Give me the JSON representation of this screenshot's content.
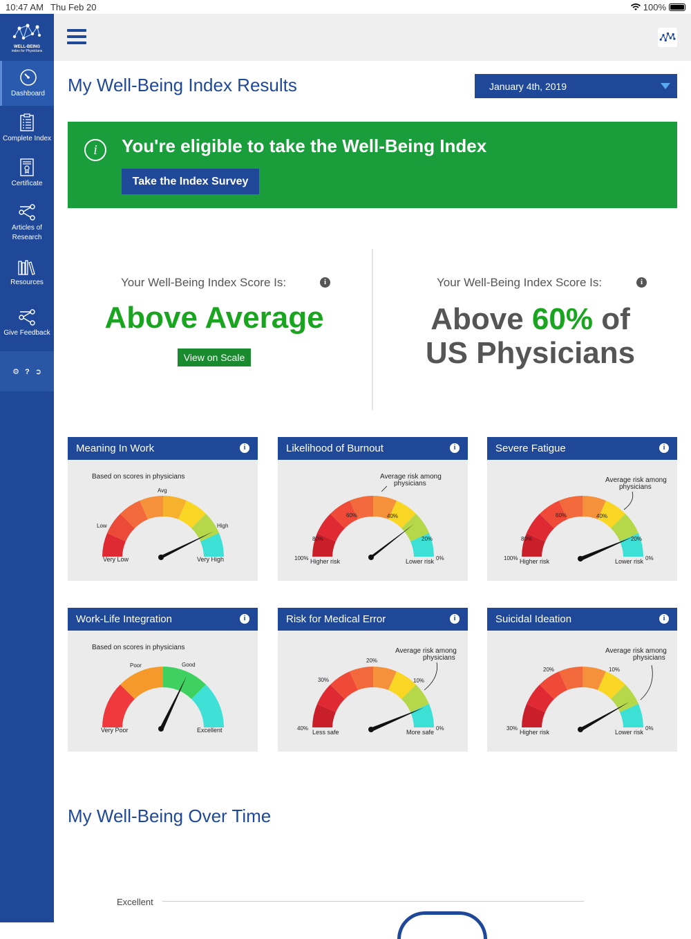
{
  "status_bar": {
    "time": "10:47 AM",
    "date": "Thu Feb 20",
    "battery": "100%"
  },
  "sidebar": {
    "logo_text": "WELL-BEING",
    "logo_sub": "index for Physicians",
    "items": [
      {
        "label": "Dashboard",
        "icon": "dashboard-gauge-icon"
      },
      {
        "label": "Complete Index",
        "icon": "checklist-icon"
      },
      {
        "label": "Certificate",
        "icon": "certificate-icon"
      },
      {
        "label": "Articles of Research",
        "icon": "share-nodes-icon"
      },
      {
        "label": "Resources",
        "icon": "books-icon"
      },
      {
        "label": "Give Feedback",
        "icon": "share-nodes-icon"
      }
    ],
    "tools": [
      "gear-icon",
      "help-icon",
      "logout-icon"
    ]
  },
  "header": {
    "title": "My Well-Being Index Results",
    "date_value": "January 4th, 2019"
  },
  "banner": {
    "message": "You're eligible to take the Well-Being Index",
    "button": "Take the Index Survey"
  },
  "score": {
    "label_left": "Your Well-Being Index Score Is:",
    "result_left": "Above Average",
    "view_scale": "View on Scale",
    "label_right": "Your Well-Being Index Score Is:",
    "result_right_pre": "Above ",
    "result_right_pct": "60%",
    "result_right_mid": " of",
    "result_right_post": "US Physicians"
  },
  "cards": [
    {
      "title": "Meaning In Work",
      "note": "Based on scores in physicians",
      "labels": [
        "Low",
        "Avg",
        "High",
        "Very Low",
        "Very High"
      ]
    },
    {
      "title": "Likelihood of Burnout",
      "note": "Average risk among physicians",
      "labels": [
        "80%",
        "60%",
        "40%",
        "20%",
        "100%",
        "0%",
        "Higher risk",
        "Lower risk"
      ]
    },
    {
      "title": "Severe Fatigue",
      "note": "Average risk among physicians",
      "labels": [
        "80%",
        "60%",
        "40%",
        "20%",
        "100%",
        "0%",
        "Higher risk",
        "Lower risk"
      ]
    },
    {
      "title": "Work-Life Integration",
      "note": "Based on scores in physicians",
      "labels": [
        "Poor",
        "Good",
        "Very Poor",
        "Excellent"
      ]
    },
    {
      "title": "Risk for Medical Error",
      "note": "Average risk among physicians",
      "labels": [
        "30%",
        "20%",
        "10%",
        "40%",
        "0%",
        "Less safe",
        "More safe"
      ]
    },
    {
      "title": "Suicidal Ideation",
      "note": "Average risk among physicians",
      "labels": [
        "20%",
        "10%",
        "30%",
        "0%",
        "Higher risk",
        "Lower risk"
      ]
    }
  ],
  "over_time": {
    "title": "My Well-Being Over Time",
    "axis_label": "Excellent"
  },
  "colors": {
    "brand_blue": "#1f4898",
    "banner_green": "#1a9d3b",
    "score_green": "#1aa520"
  }
}
